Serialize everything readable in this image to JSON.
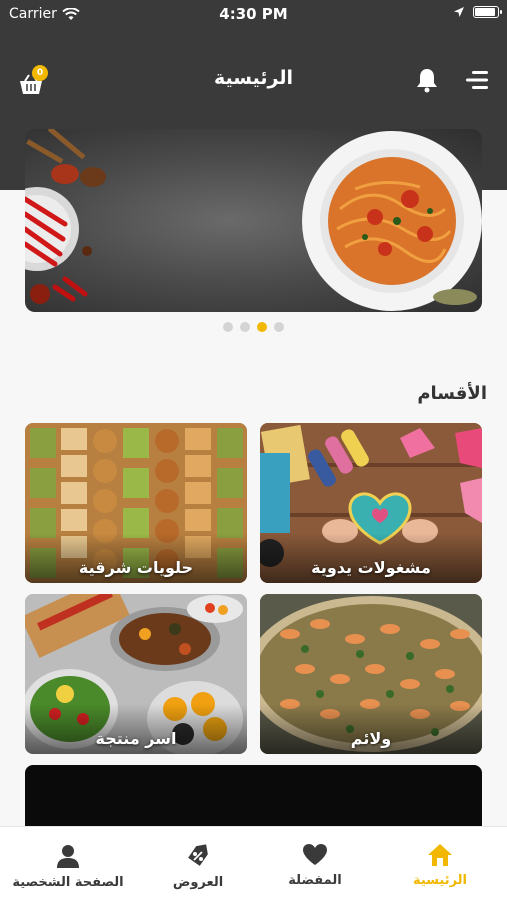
{
  "status_bar": {
    "carrier": "Carrier",
    "time": "4:30 PM"
  },
  "header": {
    "title": "الرئيسية",
    "cart_count": "0"
  },
  "banner": {
    "slides": 4,
    "active_slide": 3
  },
  "categories": {
    "title": "الأقسام",
    "items": [
      {
        "label": "مشغولات يدوية"
      },
      {
        "label": "حلويات شرقية"
      },
      {
        "label": "ولائم"
      },
      {
        "label": "اسر منتجة"
      }
    ]
  },
  "tabbar": {
    "home": "الرئيسية",
    "favorites": "المفضلة",
    "offers": "العروض",
    "profile": "الصفحة الشخصية"
  },
  "colors": {
    "accent": "#f2b800",
    "header_bg": "#3a3a3a"
  }
}
